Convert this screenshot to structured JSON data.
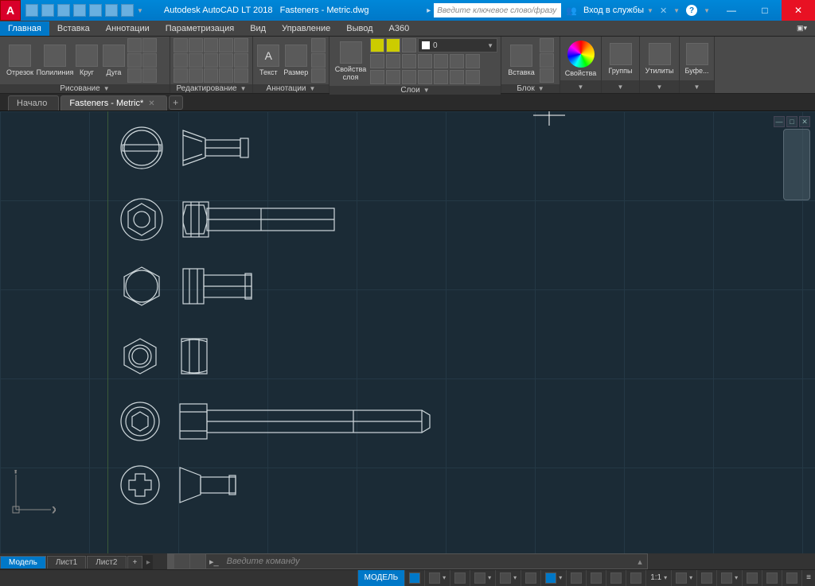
{
  "title": {
    "app": "Autodesk AutoCAD LT 2018",
    "file": "Fasteners - Metric.dwg"
  },
  "search": {
    "placeholder": "Введите ключевое слово/фразу"
  },
  "login": {
    "label": "Вход в службы"
  },
  "menu": {
    "items": [
      "Главная",
      "Вставка",
      "Аннотации",
      "Параметризация",
      "Вид",
      "Управление",
      "Вывод",
      "A360"
    ],
    "active": 0
  },
  "ribbon": {
    "draw": {
      "line": "Отрезок",
      "polyline": "Полилиния",
      "circle": "Круг",
      "arc": "Дуга",
      "title": "Рисование"
    },
    "modify": {
      "title": "Редактирование"
    },
    "annot": {
      "text": "Текст",
      "dim": "Размер",
      "title": "Аннотации"
    },
    "layers": {
      "props": "Свойства слоя",
      "title": "Слои",
      "current": "0"
    },
    "block": {
      "insert": "Вставка",
      "title": "Блок"
    },
    "props": {
      "label": "Свойства"
    },
    "groups": {
      "label": "Группы"
    },
    "util": {
      "label": "Утилиты"
    },
    "clip": {
      "label": "Буфе..."
    }
  },
  "filetabs": {
    "start": "Начало",
    "current": "Fasteners - Metric*"
  },
  "layouts": {
    "model": "Модель",
    "s1": "Лист1",
    "s2": "Лист2"
  },
  "cmd": {
    "placeholder": "Введите команду"
  },
  "status": {
    "model": "МОДЕЛЬ",
    "scale": "1:1"
  }
}
